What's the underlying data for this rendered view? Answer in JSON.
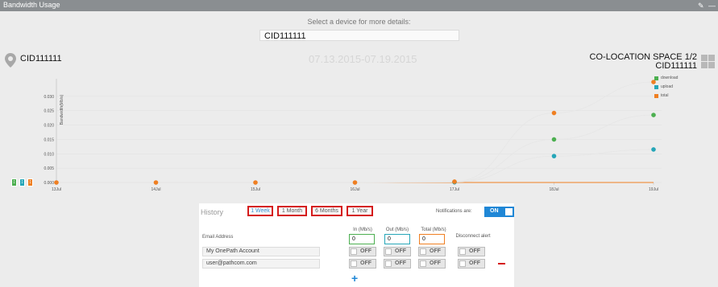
{
  "window": {
    "title": "Bandwidth Usage",
    "pin_icon": "pin-icon",
    "minimize_icon": "minimize-icon"
  },
  "selector": {
    "prompt": "Select a device for more details:",
    "device_value": "CID111111"
  },
  "header": {
    "device_name": "CID111111",
    "date_range": "07.13.2015-07.19.2015",
    "location_line1": "CO-LOCATION SPACE 1/2",
    "location_line2": "CID111111",
    "location_icon": "location-pin-icon",
    "view_icons": [
      "grid-view-icon",
      "list-view-icon"
    ]
  },
  "chart_data": {
    "type": "line",
    "ylabel": "Bandwidth(Mb/s)",
    "xlabel": "",
    "categories": [
      "13Jul",
      "14Jul",
      "15Jul",
      "16Jul",
      "17Jul",
      "18Jul",
      "19Jul"
    ],
    "y_ticks": [
      "0.000",
      "0.005",
      "0.010",
      "0.015",
      "0.020",
      "0.025",
      "0.030"
    ],
    "ylim": [
      0,
      0.035
    ],
    "grid": true,
    "legend_position": "top-right",
    "series": [
      {
        "name": "download",
        "color": "#4caf50",
        "values": [
          0,
          0,
          0,
          0,
          0.0002,
          0.015,
          0.0235
        ]
      },
      {
        "name": "upload",
        "color": "#26a6b8",
        "values": [
          0,
          0,
          0,
          0,
          0.0001,
          0.0092,
          0.0115
        ]
      },
      {
        "name": "total",
        "color": "#ef7f22",
        "values": [
          0,
          0,
          0,
          0,
          0.0003,
          0.0242,
          0.035
        ]
      }
    ]
  },
  "chart_controls": [
    "zoom-green-icon",
    "zoom-blue-icon",
    "zoom-orange-icon"
  ],
  "history": {
    "label": "History",
    "ranges": [
      "1 Week",
      "1 Month",
      "6 Months",
      "1 Year"
    ],
    "notifications_label": "Notifications are:",
    "notifications_state": "ON",
    "columns": {
      "email": "Email Address",
      "in": "In (Mb/s)",
      "out": "Out (Mb/s)",
      "total": "Total (Mb/s)",
      "disconnect": "Disconnect alert"
    },
    "thresholds": {
      "in": "0",
      "out": "0",
      "total": "0"
    },
    "threshold_colors": {
      "in": "#4caf50",
      "out": "#26a6b8",
      "total": "#ef7f22"
    },
    "rows": [
      {
        "email": "My OnePath Account",
        "in": "OFF",
        "out": "OFF",
        "total": "OFF",
        "disconnect": "OFF"
      },
      {
        "email": "user@pathcom.com",
        "in": "OFF",
        "out": "OFF",
        "total": "OFF",
        "disconnect": "OFF"
      }
    ],
    "add_icon": "add-icon",
    "remove_icon": "remove-icon"
  }
}
